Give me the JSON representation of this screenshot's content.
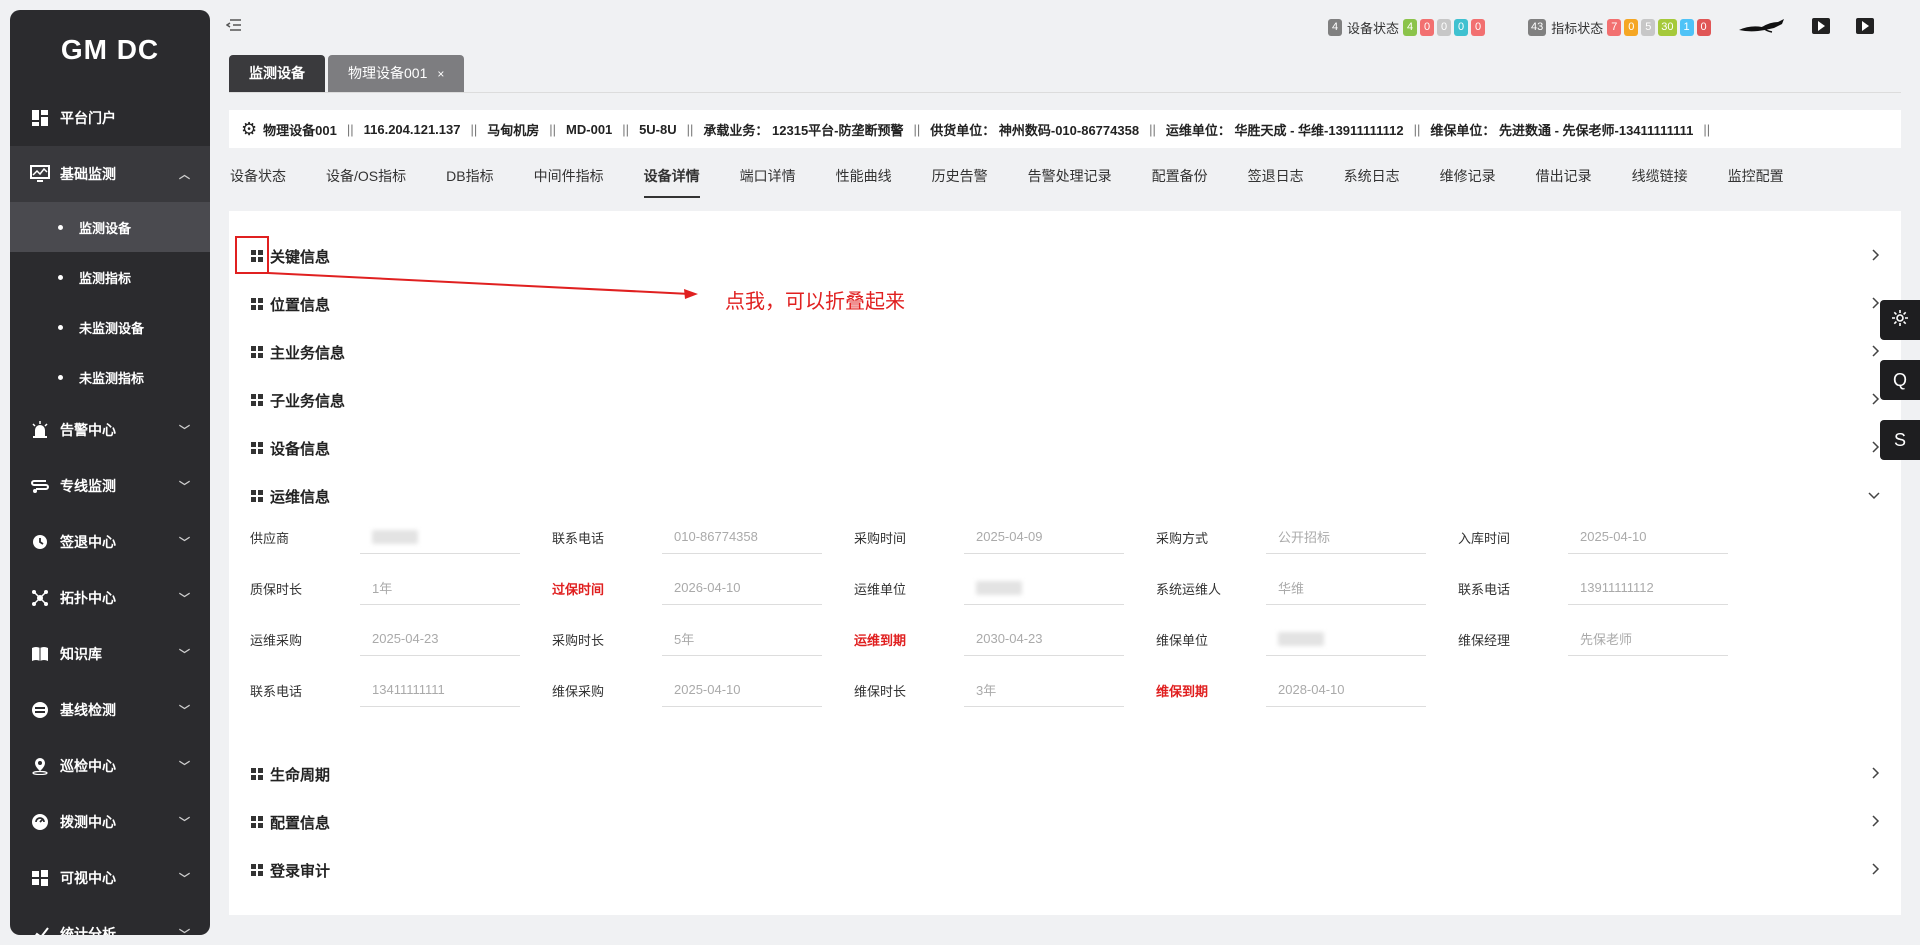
{
  "sidebar": {
    "logo": "GM DC",
    "items": [
      {
        "label": "平台门户",
        "icon": "dashboard-icon"
      },
      {
        "label": "基础监测",
        "icon": "monitor-icon",
        "open": true,
        "children": [
          {
            "label": "监测设备",
            "active": true
          },
          {
            "label": "监测指标"
          },
          {
            "label": "未监测设备"
          },
          {
            "label": "未监测指标"
          }
        ]
      },
      {
        "label": "告警中心",
        "icon": "alarm-icon"
      },
      {
        "label": "专线监测",
        "icon": "line-icon"
      },
      {
        "label": "签退中心",
        "icon": "clock-icon"
      },
      {
        "label": "拓扑中心",
        "icon": "topology-icon"
      },
      {
        "label": "知识库",
        "icon": "book-icon"
      },
      {
        "label": "基线检测",
        "icon": "baseline-icon"
      },
      {
        "label": "巡检中心",
        "icon": "location-icon"
      },
      {
        "label": "拨测中心",
        "icon": "dial-icon"
      },
      {
        "label": "可视中心",
        "icon": "windows-icon"
      },
      {
        "label": "统计分析",
        "icon": "chart-icon"
      }
    ]
  },
  "topbar": {
    "device_status": {
      "count": "4",
      "label": "设备状态",
      "badges": [
        "4",
        "0",
        "0",
        "0",
        "0"
      ]
    },
    "indicator_status": {
      "count": "43",
      "label": "指标状态",
      "badges": [
        "7",
        "0",
        "5",
        "30",
        "1",
        "0"
      ]
    },
    "colors": {
      "gray": "#808080",
      "green": "#8bc34a",
      "orange": "#f5a623",
      "red": "#f27070",
      "lightgray": "#c7c7c7",
      "cyan": "#3fc1d0",
      "blue": "#4fc3f7",
      "yellowgreen": "#a5c93a",
      "darkred": "#e05656"
    }
  },
  "tabs": [
    {
      "label": "监测设备",
      "active": true
    },
    {
      "label": "物理设备001",
      "closable": true,
      "close": "×"
    }
  ],
  "info_bar": {
    "items": [
      "物理设备001",
      "116.204.121.137",
      "马甸机房",
      "MD-001",
      "5U-8U",
      "承载业务： 12315平台-防垄断预警",
      "供货单位： 神州数码-010-86774358",
      "运维单位： 华胜天成 - 华维-13911111112",
      "维保单位： 先进数通 - 先保老师-13411111111"
    ],
    "separator": "||"
  },
  "subtabs": [
    "设备状态",
    "设备/OS指标",
    "DB指标",
    "中间件指标",
    "设备详情",
    "端口详情",
    "性能曲线",
    "历史告警",
    "告警处理记录",
    "配置备份",
    "签退日志",
    "系统日志",
    "维修记录",
    "借出记录",
    "线缆链接",
    "监控配置"
  ],
  "subtab_active": "设备详情",
  "sections": {
    "top": [
      "关键信息",
      "位置信息",
      "主业务信息",
      "子业务信息",
      "设备信息",
      "运维信息"
    ],
    "bottom": [
      "生命周期",
      "配置信息",
      "登录审计"
    ]
  },
  "annotation": {
    "text": "点我，可以折叠起来"
  },
  "ops_fields": [
    [
      {
        "label": "供应商",
        "value": "",
        "blurred": true
      },
      {
        "label": "联系电话",
        "value": "010-86774358"
      },
      {
        "label": "采购时间",
        "value": "2025-04-09"
      },
      {
        "label": "采购方式",
        "value": "公开招标"
      },
      {
        "label": "入库时间",
        "value": "2025-04-10"
      }
    ],
    [
      {
        "label": "质保时长",
        "value": "1年"
      },
      {
        "label": "过保时间",
        "value": "2026-04-10",
        "red": true
      },
      {
        "label": "运维单位",
        "value": "",
        "blurred": true
      },
      {
        "label": "系统运维人",
        "value": "华维"
      },
      {
        "label": "联系电话",
        "value": "13911111112"
      }
    ],
    [
      {
        "label": "运维采购",
        "value": "2025-04-23"
      },
      {
        "label": "采购时长",
        "value": "5年"
      },
      {
        "label": "运维到期",
        "value": "2030-04-23",
        "red": true
      },
      {
        "label": "维保单位",
        "value": "",
        "blurred": true
      },
      {
        "label": "维保经理",
        "value": "先保老师"
      }
    ],
    [
      {
        "label": "联系电话",
        "value": "13411111111"
      },
      {
        "label": "维保采购",
        "value": "2025-04-10"
      },
      {
        "label": "维保时长",
        "value": "3年"
      },
      {
        "label": "维保到期",
        "value": "2028-04-10",
        "red": true
      }
    ]
  ],
  "float_buttons": [
    {
      "label": "",
      "icon": "settings-icon"
    },
    {
      "label": "Q"
    },
    {
      "label": "S"
    }
  ]
}
